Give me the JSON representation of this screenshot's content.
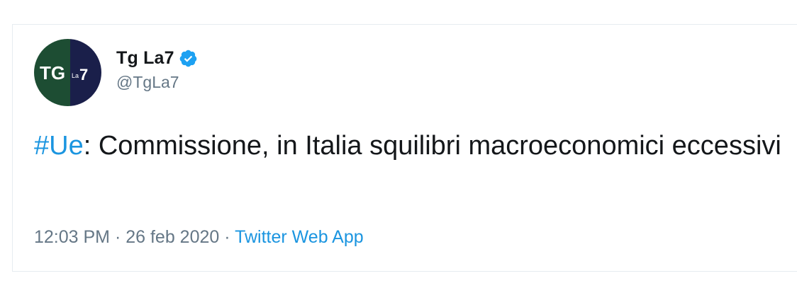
{
  "author": {
    "display_name": "Tg La7",
    "handle": "@TgLa7",
    "verified_icon": "verified-badge-icon",
    "avatar_logo_text": "TG La7"
  },
  "tweet": {
    "hashtag": "#Ue",
    "text_after_hashtag": ": Commissione, in Italia squilibri macroeconomici eccessivi"
  },
  "meta": {
    "time": "12:03 PM",
    "separator1": " · ",
    "date": "26 feb 2020",
    "separator2": " · ",
    "source": "Twitter Web App"
  },
  "colors": {
    "link": "#1b95e0",
    "text": "#14171a",
    "secondary": "#657786",
    "avatar_green": "#1d5a3a",
    "avatar_navy": "#1c2a5a"
  }
}
